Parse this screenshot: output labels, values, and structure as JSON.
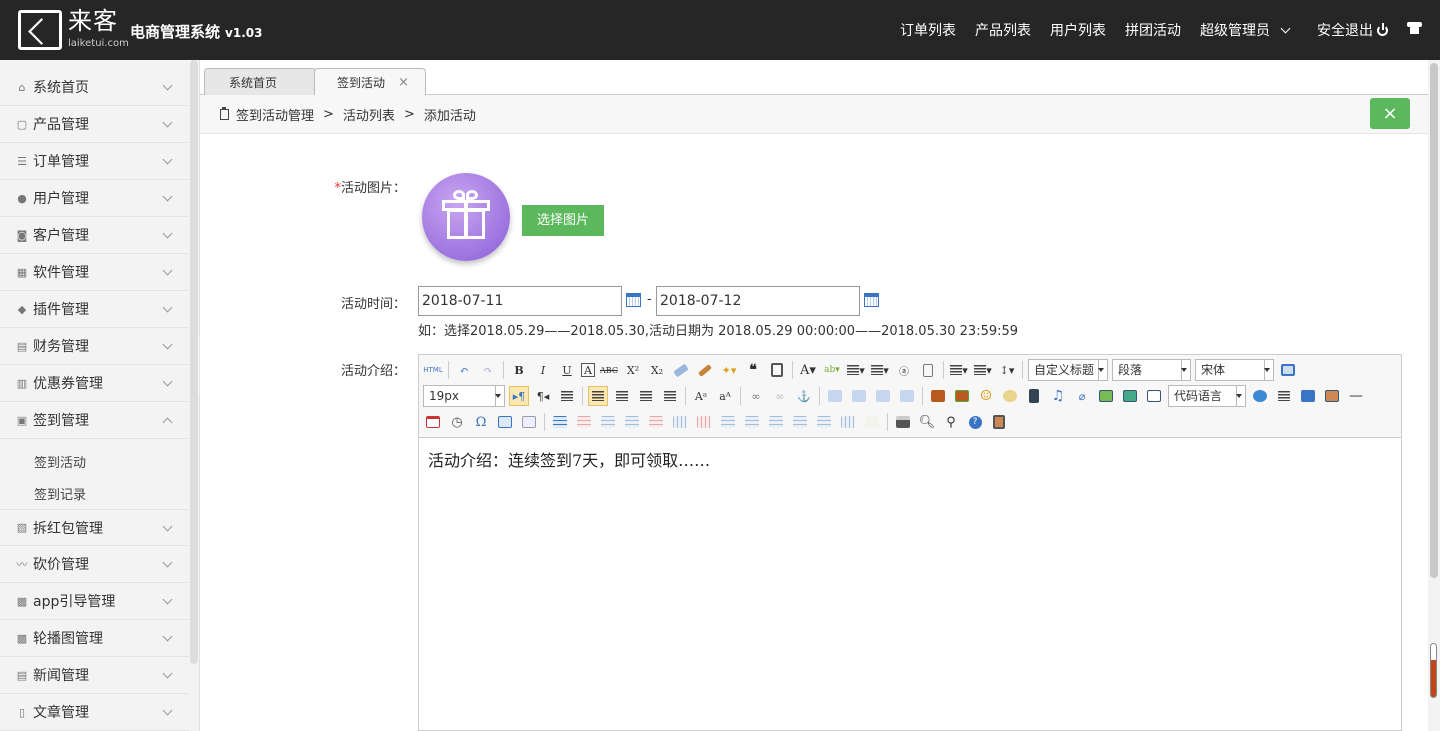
{
  "header": {
    "logo_text": "来客",
    "logo_sub": "laiketui.com",
    "app_title": "电商管理系统",
    "version": "v1.03",
    "nav": [
      "订单列表",
      "产品列表",
      "用户列表",
      "拼团活动"
    ],
    "admin_label": "超级管理员",
    "logout_label": "安全退出"
  },
  "sidebar": {
    "items": [
      {
        "label": "系统首页",
        "icon": "home-icon"
      },
      {
        "label": "产品管理",
        "icon": "bag-icon"
      },
      {
        "label": "订单管理",
        "icon": "list-icon"
      },
      {
        "label": "用户管理",
        "icon": "user-icon"
      },
      {
        "label": "客户管理",
        "icon": "customer-icon"
      },
      {
        "label": "软件管理",
        "icon": "grid-icon"
      },
      {
        "label": "插件管理",
        "icon": "puzzle-icon"
      },
      {
        "label": "财务管理",
        "icon": "finance-icon"
      },
      {
        "label": "优惠券管理",
        "icon": "coupon-icon"
      },
      {
        "label": "签到管理",
        "icon": "checkin-icon"
      },
      {
        "label": "拆红包管理",
        "icon": "redpacket-icon"
      },
      {
        "label": "砍价管理",
        "icon": "bargain-icon"
      },
      {
        "label": "app引导管理",
        "icon": "image-icon"
      },
      {
        "label": "轮播图管理",
        "icon": "image-icon"
      },
      {
        "label": "新闻管理",
        "icon": "news-icon"
      },
      {
        "label": "文章管理",
        "icon": "file-icon"
      }
    ],
    "sub_items": [
      "签到活动",
      "签到记录"
    ]
  },
  "tabs": [
    {
      "label": "系统首页"
    },
    {
      "label": "签到活动",
      "close": "×"
    }
  ],
  "breadcrumb": {
    "parts": [
      "签到活动管理",
      "活动列表",
      "添加活动"
    ],
    "separator": ">"
  },
  "close_button": "×",
  "form": {
    "image_label": "活动图片：",
    "required_mark": "*",
    "choose_image_button": "选择图片",
    "time_label": "活动时间：",
    "start_date": "2018-07-11",
    "end_date": "2018-07-12",
    "date_separator": "-",
    "date_hint": "如：选择2018.05.29——2018.05.30,活动日期为 2018.05.29 00:00:00——2018.05.30 23:59:59",
    "intro_label": "活动介绍："
  },
  "editor": {
    "font_size": "19px",
    "custom_heading": "自定义标题",
    "paragraph": "段落",
    "font_family": "宋体",
    "code_language": "代码语言",
    "content": "活动介绍：连续签到7天，即可领取……"
  },
  "colors": {
    "topbar": "#262626",
    "accent_green": "#5cb85c",
    "gift_purple": "#8a5cd8"
  }
}
